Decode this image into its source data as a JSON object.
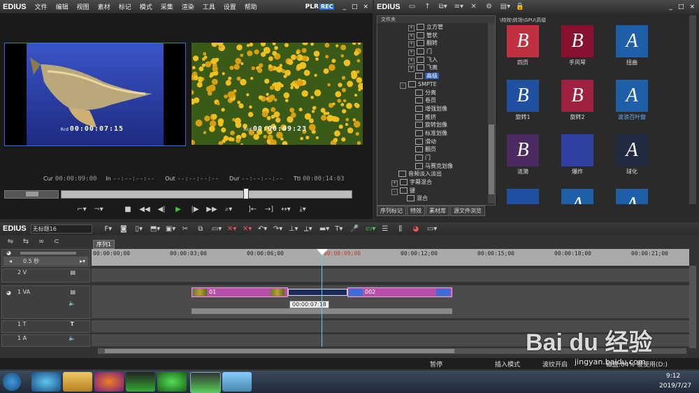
{
  "player": {
    "logo": "EDIUS",
    "menu": [
      "文件",
      "编辑",
      "视图",
      "素材",
      "标记",
      "模式",
      "采集",
      "渲染",
      "工具",
      "设置",
      "帮助"
    ],
    "plr": "PLR",
    "rec": "REC",
    "win_controls": [
      "_",
      "□",
      "×"
    ],
    "player_tc_prefix": "Rcd",
    "player_tc": "00:00:07:15",
    "recorder_tc_prefix": "Rcd",
    "recorder_tc": "00:00:09:23",
    "cur_label": "Cur",
    "cur_val": "00:00:09:00",
    "in_label": "In",
    "in_val": "--:--:--:--",
    "out_label": "Out",
    "out_val": "--:--:--:--",
    "dur_label": "Dur",
    "dur_val": "--:--:--:--",
    "ttl_label": "Ttl",
    "ttl_val": "00:00:14:03"
  },
  "bin": {
    "logo": "EDIUS",
    "folder_header": "文件夹",
    "path": "\\特效\\转场\\GPU\\高级",
    "tree": [
      {
        "label": "立方管",
        "indent": 2,
        "pm": "+"
      },
      {
        "label": "管状",
        "indent": 2,
        "pm": "+"
      },
      {
        "label": "翻转",
        "indent": 2,
        "pm": "+"
      },
      {
        "label": "门",
        "indent": 2,
        "pm": "+"
      },
      {
        "label": "飞入",
        "indent": 2,
        "pm": "+"
      },
      {
        "label": "飞离",
        "indent": 2,
        "pm": "+"
      },
      {
        "label": "高级",
        "indent": 2,
        "pm": "",
        "sel": true
      },
      {
        "label": "SMPTE",
        "indent": 1,
        "pm": "-"
      },
      {
        "label": "分离",
        "indent": 2,
        "pm": ""
      },
      {
        "label": "卷页",
        "indent": 2,
        "pm": ""
      },
      {
        "label": "增强划像",
        "indent": 2,
        "pm": ""
      },
      {
        "label": "推挤",
        "indent": 2,
        "pm": ""
      },
      {
        "label": "旋转划像",
        "indent": 2,
        "pm": ""
      },
      {
        "label": "标准划像",
        "indent": 2,
        "pm": ""
      },
      {
        "label": "滑动",
        "indent": 2,
        "pm": ""
      },
      {
        "label": "翻页",
        "indent": 2,
        "pm": ""
      },
      {
        "label": "门",
        "indent": 2,
        "pm": ""
      },
      {
        "label": "马赛克划像",
        "indent": 2,
        "pm": ""
      },
      {
        "label": "音频淡入淡出",
        "indent": 0,
        "pm": ""
      },
      {
        "label": "字幕混合",
        "indent": 0,
        "pm": "+"
      },
      {
        "label": "键",
        "indent": 0,
        "pm": "-"
      },
      {
        "label": "混合",
        "indent": 1,
        "pm": ""
      }
    ],
    "tiles": [
      {
        "label": "四页",
        "letter": "B",
        "bg": "#c03040",
        "col": 0,
        "row": 0
      },
      {
        "label": "手风琴",
        "letter": "B",
        "bg": "#8a1030",
        "col": 1,
        "row": 0
      },
      {
        "label": "扭曲",
        "letter": "A",
        "bg": "#1d5fa8",
        "col": 2,
        "row": 0
      },
      {
        "label": "旋转1",
        "letter": "B",
        "bg": "#2050a0",
        "col": 0,
        "row": 1
      },
      {
        "label": "旋转2",
        "letter": "B",
        "bg": "#a02040",
        "col": 1,
        "row": 1
      },
      {
        "label": "波浪百叶窗",
        "letter": "A",
        "bg": "#1d5fa8",
        "col": 2,
        "row": 1,
        "sel": true
      },
      {
        "label": "涟漪",
        "letter": "B",
        "bg": "#4a2a60",
        "col": 0,
        "row": 2
      },
      {
        "label": "爆炸",
        "letter": "",
        "bg": "#3040a0",
        "col": 1,
        "row": 2
      },
      {
        "label": "球化",
        "letter": "A",
        "bg": "#202a40",
        "col": 2,
        "row": 2
      },
      {
        "label": "",
        "letter": "",
        "bg": "#2050a0",
        "col": 0,
        "row": 3
      },
      {
        "label": "",
        "letter": "A",
        "bg": "#1d5fa8",
        "col": 1,
        "row": 3
      },
      {
        "label": "",
        "letter": "A",
        "bg": "#1d5fa8",
        "col": 2,
        "row": 3
      }
    ],
    "tabs": [
      "序列标记",
      "特效",
      "素材库",
      "源文件浏览"
    ]
  },
  "timeline": {
    "logo": "EDIUS",
    "project": "无标题16",
    "sequence_tab": "序列1",
    "scale": "0.5 秒",
    "ruler": [
      "00:00:00;00",
      "00:00:03;00",
      "00:00:06;00",
      "00:00:09;00",
      "00:00:12;00",
      "00:00:15;00",
      "00:00:18;00",
      "00:00:21;00"
    ],
    "tracks": {
      "v2": "2 V",
      "va1": "1 VA",
      "t1": "1 T",
      "a1": "1 A"
    },
    "clip1": "01",
    "clip2": "002",
    "tooltip": "00:00:07:18"
  },
  "status": {
    "pause": "暂停",
    "insert": "插入模式",
    "ripple": "波纹开启",
    "disk": "磁盘:84% 被使用(D:)"
  },
  "taskbar": {
    "time": "9:12",
    "date": "2019/7/27"
  },
  "watermark": {
    "brand": "Bai du 经验",
    "url": "jingyan.baidu.com"
  }
}
